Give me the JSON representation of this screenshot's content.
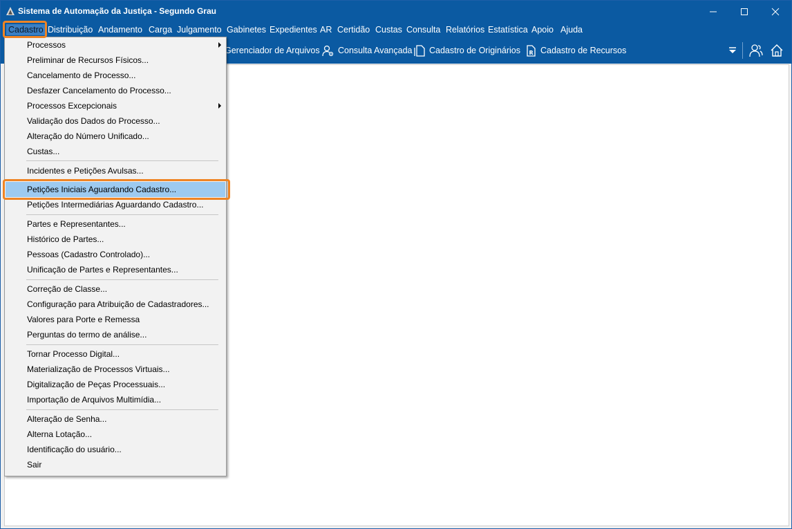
{
  "window": {
    "title": "Sistema de Automação da Justiça - Segundo Grau",
    "controls": {
      "minimize": "minimize-icon",
      "maximize": "maximize-icon",
      "close": "close-icon"
    }
  },
  "menubar": {
    "items": [
      "Cadastro",
      "Distribuição",
      "Andamento",
      "Carga",
      "Julgamento",
      "Gabinetes",
      "Expedientes",
      "AR",
      "Certidão",
      "Custas",
      "Consulta",
      "Relatórios",
      "Estatística",
      "Apoio",
      "Ajuda"
    ],
    "active": "Cadastro"
  },
  "toolbar": {
    "gerenciador": "Gerenciador de Arquivos",
    "consulta": "Consulta Avançada",
    "originarios": "Cadastro de Originários",
    "recursos": "Cadastro de Recursos"
  },
  "dropdown": {
    "items": [
      "Processos",
      "Preliminar de Recursos Físicos...",
      "Cancelamento de Processo...",
      "Desfazer Cancelamento do Processo...",
      "Processos Excepcionais",
      "Validação dos Dados do Processo...",
      "Alteração do Número Unificado...",
      "Custas...",
      "Incidentes e Petições Avulsas...",
      "Petições Iniciais Aguardando Cadastro...",
      "Petições Intermediárias Aguardando Cadastro...",
      "Partes e Representantes...",
      "Histórico de Partes...",
      "Pessoas (Cadastro Controlado)...",
      "Unificação de Partes e Representantes...",
      "Correção de Classe...",
      "Configuração para Atribuição de Cadastradores...",
      "Valores para Porte e Remessa",
      "Perguntas do termo de análise...",
      "Tornar Processo Digital...",
      "Materialização de Processos Virtuais...",
      "Digitalização de Peças Processuais...",
      "Importação de Arquivos Multimídia...",
      "Alteração de Senha...",
      "Alterna Lotação...",
      "Identificação do usuário...",
      "Sair"
    ],
    "highlighted": "Petições Iniciais Aguardando Cadastro..."
  },
  "colors": {
    "titlebar": "#0b5aa2",
    "highlight": "#9dcaf0",
    "annotation": "#ef8424"
  }
}
